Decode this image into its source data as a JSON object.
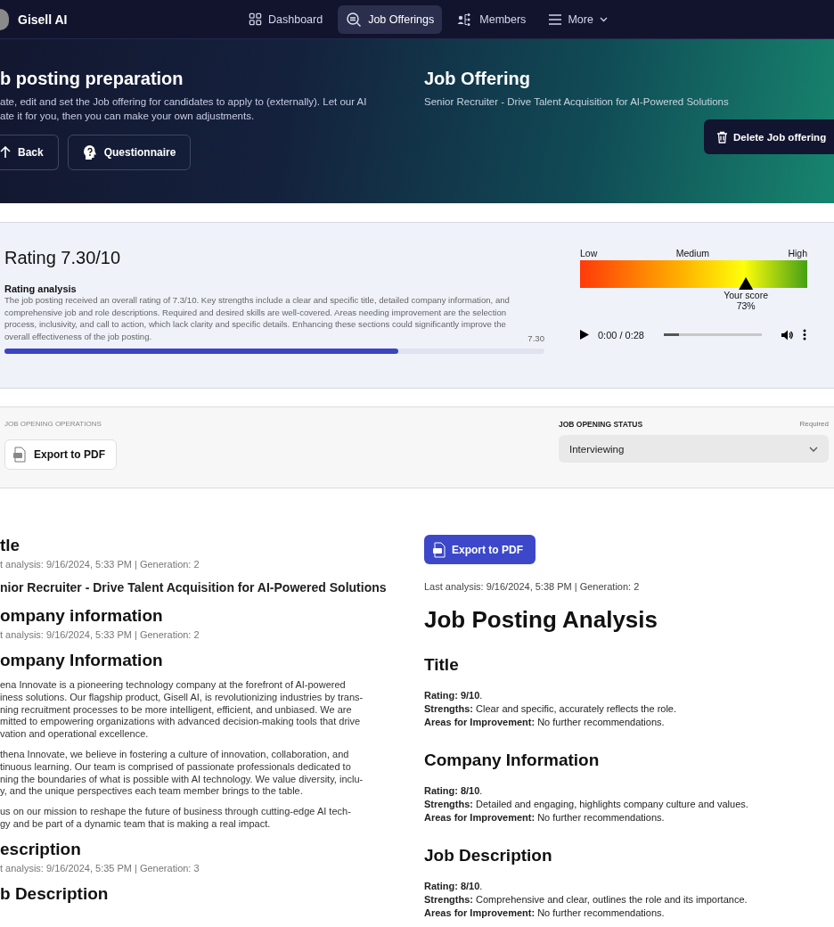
{
  "nav": {
    "brand": "Gisell AI",
    "items": [
      {
        "label": "Dashboard",
        "kind": "grid",
        "selected": false
      },
      {
        "label": "Job Offerings",
        "kind": "jobs",
        "selected": true
      },
      {
        "label": "Members",
        "kind": "members",
        "selected": false
      },
      {
        "label": "More",
        "kind": "menu",
        "selected": false
      }
    ]
  },
  "hero": {
    "title": "b posting preparation",
    "description_lines": [
      "ate, edit and set the Job offering for candidates to apply to (externally).  Let our AI",
      "ate it for you, then you can make your own adjustments."
    ],
    "buttons": [
      {
        "label": "Back",
        "kind": "back"
      },
      {
        "label": "Questionnaire",
        "kind": "questionnaire"
      }
    ],
    "offering_title": "Job Offering",
    "offering_subtitle": "Senior Recruiter - Drive Talent Acquisition for AI-Powered Solutions",
    "delete_button": "Delete Job offering"
  },
  "rating": {
    "title": "Rating 7.30/10",
    "analysis_heading": "Rating analysis",
    "analysis_text": "The job posting received an overall rating of 7.3/10. Key strengths include a clear and specific title, detailed company information, and comprehensive job and role descriptions. Required and desired skills are well-covered. Areas needing improvement are the selection process, inclusivity, and call to action, which lack clarity and specific details. Enhancing these sections could significantly improve the overall effectiveness of the job posting.",
    "value": "7.30",
    "level": 0.73,
    "scale": {
      "labels": [
        "Low",
        "Medium",
        "High"
      ],
      "level": 0.73,
      "marker_label": "Your score",
      "marker_value": "73%"
    },
    "audio": {
      "time": "0:00 / 0:28",
      "level": 0.15
    }
  },
  "operations": {
    "label": "JOB OPENING OPERATIONS",
    "export_button": "Export to PDF",
    "status_label": "JOB OPENING STATUS",
    "required": "Required",
    "status_value": "Interviewing"
  },
  "left_sections": [
    {
      "kind": "section",
      "heading": "tle",
      "meta": "t analysis: 9/16/2024, 5:33 PM | Generation: 2"
    },
    {
      "kind": "value",
      "text": "nior Recruiter - Drive Talent Acquisition for AI-Powered Solutions"
    },
    {
      "kind": "section",
      "heading": "ompany information",
      "meta": "t analysis: 9/16/2024, 5:33 PM | Generation: 2"
    },
    {
      "kind": "subheading",
      "text": "ompany Information"
    },
    {
      "kind": "paragraph",
      "lines": [
        "ena Innovate is a pioneering technology company at the forefront of AI-powered",
        "iness solutions. Our flagship product, Gisell AI, is revolutionizing industries by trans-",
        "ning recruitment processes to be more intelligent, efficient, and unbiased. We are",
        "mitted to empowering organizations with advanced decision-making tools that drive",
        "vation and operational excellence."
      ]
    },
    {
      "kind": "paragraph",
      "lines": [
        "thena Innovate, we believe in fostering a culture of innovation, collaboration, and",
        "tinuous learning. Our team is comprised of passionate professionals dedicated to",
        "ning the boundaries of what is possible with AI technology. We value diversity, inclu-",
        "y, and the unique perspectives each team member brings to the table."
      ]
    },
    {
      "kind": "paragraph",
      "lines": [
        "us on our mission to reshape the future of business through cutting-edge AI tech-",
        "gy and be part of a dynamic team that is making a real impact."
      ]
    },
    {
      "kind": "section",
      "heading": "escription",
      "meta": "t analysis: 9/16/2024, 5:35 PM | Generation: 3"
    },
    {
      "kind": "subheading",
      "text": "b Description"
    }
  ],
  "analysis": {
    "export_button": "Export to PDF",
    "meta": "Last analysis: 9/16/2024, 5:38 PM | Generation: 2",
    "title": "Job Posting Analysis",
    "sections": [
      {
        "heading": "Title",
        "lines": [
          "**Rating: 9/10**.",
          "**Strengths:** Clear and specific, accurately reflects the role.",
          "**Areas for Improvement:** No further recommendations."
        ]
      },
      {
        "heading": "Company Information",
        "lines": [
          "**Rating: 8/10**.",
          "**Strengths:** Detailed and engaging, highlights company culture and values.",
          "**Areas for Improvement:** No further recommendations."
        ]
      },
      {
        "heading": "Job Description",
        "lines": [
          "**Rating: 8/10**.",
          "**Strengths:** Comprehensive and clear, outlines the role and its importance.",
          "**Areas for Improvement:** No further recommendations."
        ]
      }
    ]
  }
}
